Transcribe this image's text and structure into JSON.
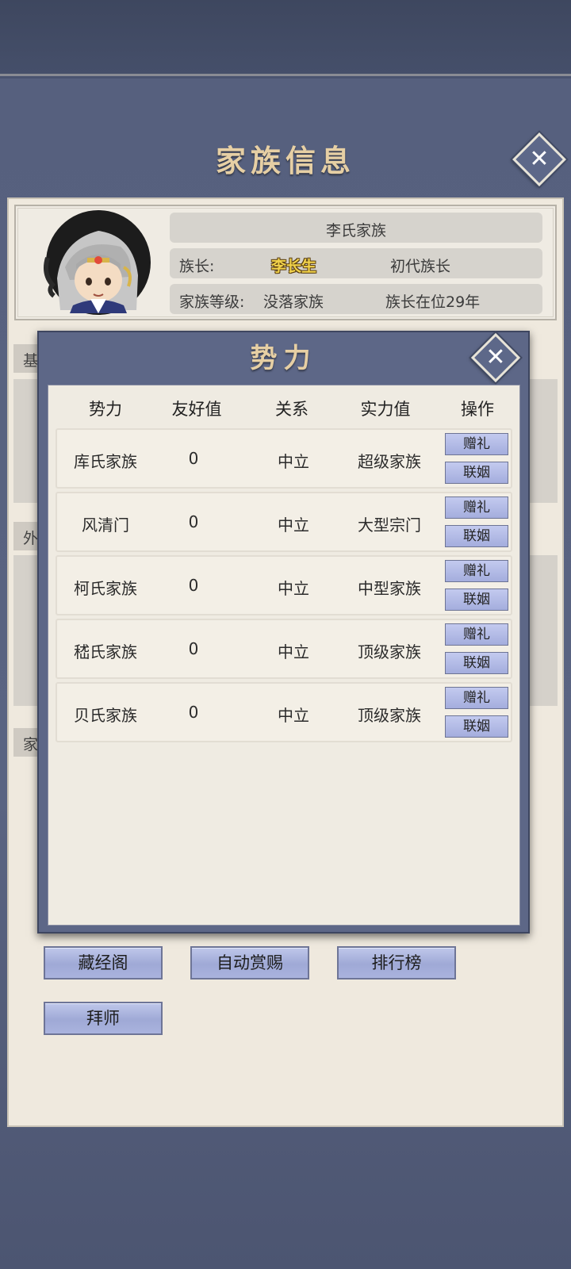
{
  "page": {
    "title": "家族信息"
  },
  "family": {
    "name": "李氏家族",
    "leader_label": "族长:",
    "leader_name": "李长生",
    "leader_rank": "初代族长",
    "level_label": "家族等级:",
    "level_value": "没落家族",
    "tenure": "族长在位29年"
  },
  "background_sections": [
    {
      "label": "基"
    },
    {
      "label": "外"
    },
    {
      "label": "家"
    }
  ],
  "bottom_buttons": [
    "藏经阁",
    "自动赏赐",
    "排行榜",
    "拜师"
  ],
  "dialog": {
    "title": "势力",
    "columns": [
      "势力",
      "友好值",
      "关系",
      "实力值",
      "操作"
    ],
    "rows": [
      {
        "name": "库氏家族",
        "friendliness": "0",
        "relation": "中立",
        "strength": "超级家族",
        "gift": "赠礼",
        "marriage": "联姻"
      },
      {
        "name": "风清门",
        "friendliness": "0",
        "relation": "中立",
        "strength": "大型宗门",
        "gift": "赠礼",
        "marriage": "联姻"
      },
      {
        "name": "柯氏家族",
        "friendliness": "0",
        "relation": "中立",
        "strength": "中型家族",
        "gift": "赠礼",
        "marriage": "联姻"
      },
      {
        "name": "嵇氏家族",
        "friendliness": "0",
        "relation": "中立",
        "strength": "顶级家族",
        "gift": "赠礼",
        "marriage": "联姻"
      },
      {
        "name": "贝氏家族",
        "friendliness": "0",
        "relation": "中立",
        "strength": "顶级家族",
        "gift": "赠礼",
        "marriage": "联姻"
      }
    ]
  },
  "colors": {
    "title_gold": "#e6cfa4",
    "dialog_frame": "#5d6787",
    "button_blue": "#a4addd",
    "leader_name": "#f1d24a"
  },
  "icons": {
    "close": "close-icon",
    "avatar": "avatar-portrait"
  }
}
